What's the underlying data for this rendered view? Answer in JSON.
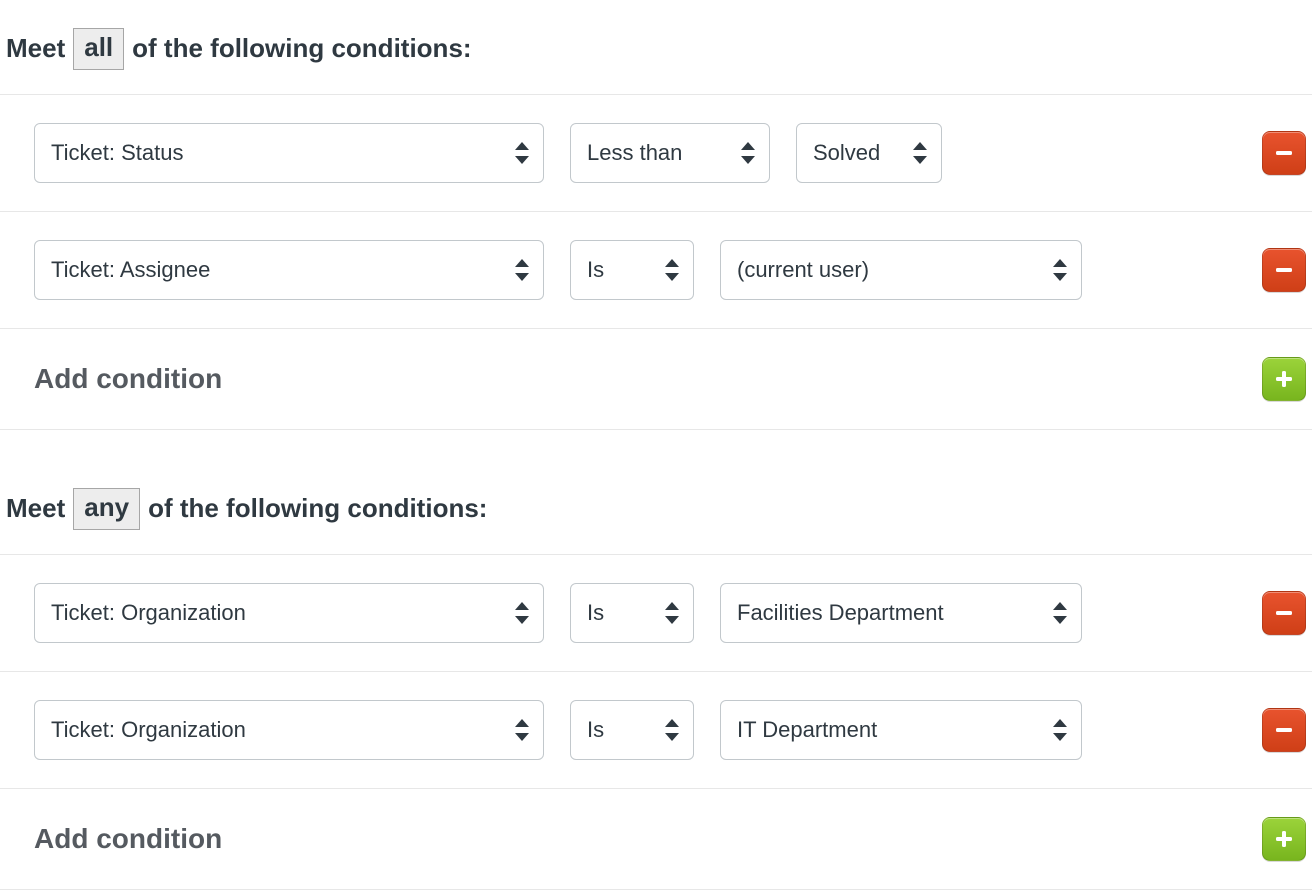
{
  "groups": [
    {
      "header_prefix": "Meet",
      "header_chip": "all",
      "header_suffix": "of the following conditions:",
      "add_label": "Add condition",
      "rows": [
        {
          "field": "Ticket: Status",
          "op": "Less than",
          "op_w": "lg",
          "value": "Solved",
          "val_w": "sm"
        },
        {
          "field": "Ticket: Assignee",
          "op": "Is",
          "op_w": "sm",
          "value": "(current user)",
          "val_w": "lg"
        }
      ]
    },
    {
      "header_prefix": "Meet",
      "header_chip": "any",
      "header_suffix": "of the following conditions:",
      "add_label": "Add condition",
      "rows": [
        {
          "field": "Ticket: Organization",
          "op": "Is",
          "op_w": "sm",
          "value": "Facilities Department",
          "val_w": "lg"
        },
        {
          "field": "Ticket: Organization",
          "op": "Is",
          "op_w": "sm",
          "value": "IT Department",
          "val_w": "lg"
        }
      ]
    }
  ]
}
